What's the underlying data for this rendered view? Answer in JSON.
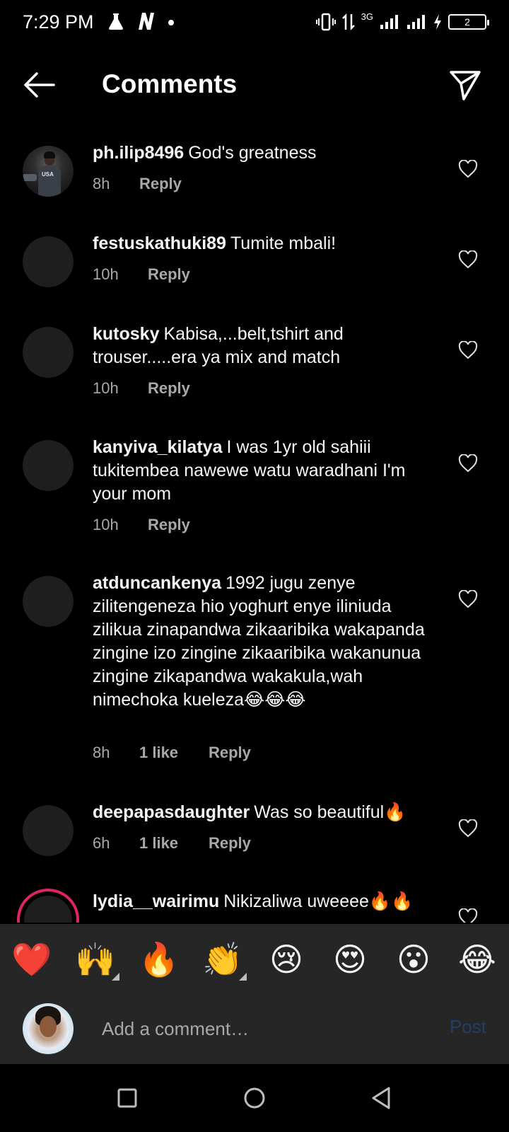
{
  "status_bar": {
    "time": "7:29 PM",
    "network": "3G",
    "battery": "2"
  },
  "header": {
    "title": "Comments"
  },
  "comments": [
    {
      "user": "ph.ilip8496",
      "text": "God's greatness",
      "time": "8h",
      "likes": "",
      "reply": "Reply"
    },
    {
      "user": "festuskathuki89",
      "text": "Tumite mbali!",
      "time": "10h",
      "likes": "",
      "reply": "Reply"
    },
    {
      "user": "kutosky",
      "text": "Kabisa,...belt,tshirt and trouser.....era ya mix and match",
      "time": "10h",
      "likes": "",
      "reply": "Reply"
    },
    {
      "user": "kanyiva_kilatya",
      "text": "I was 1yr old sahiii tukitembea nawewe watu waradhani I'm your mom",
      "time": "10h",
      "likes": "",
      "reply": "Reply"
    },
    {
      "user": "atduncankenya",
      "text": "1992 jugu zenye zilitengeneza hio  yoghurt enye iliniuda zilikua zinapandwa zikaaribika wakapanda zingine izo zingine zikaaribika wakanunua zingine zikapandwa wakakula,wah nimechoka kueleza😂😂😂",
      "time": "8h",
      "likes": "1 like",
      "reply": "Reply"
    },
    {
      "user": "deepapasdaughter",
      "text": "Was so beautiful🔥",
      "time": "6h",
      "likes": "1 like",
      "reply": "Reply"
    },
    {
      "user": "lydia__wairimu",
      "text": "Nikizaliwa uweeee🔥🔥",
      "time": "",
      "likes": "",
      "reply": ""
    }
  ],
  "emoji_bar": [
    "❤️",
    "🙌",
    "🔥",
    "👏",
    "😢",
    "😍",
    "😮",
    "😂"
  ],
  "comment_input": {
    "placeholder": "Add a comment…",
    "post_label": "Post"
  }
}
